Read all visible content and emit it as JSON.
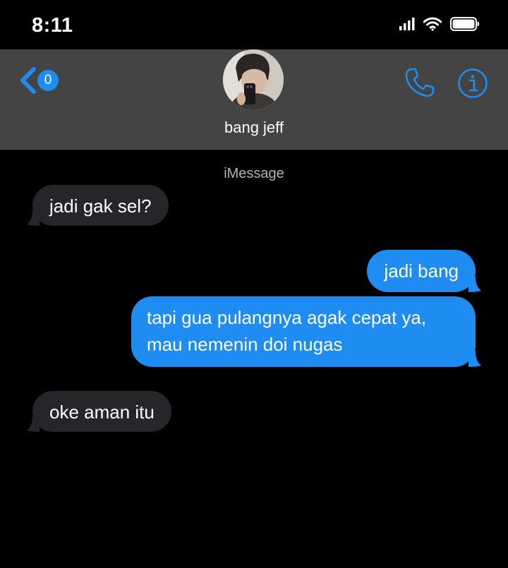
{
  "status_bar": {
    "time": "8:11",
    "icons": [
      "cellular-signal-icon",
      "wifi-icon",
      "battery-icon"
    ]
  },
  "header": {
    "back_badge_count": "0",
    "contact_name": "bang jeff",
    "actions": [
      "phone-icon",
      "info-icon"
    ]
  },
  "conversation": {
    "service_label": "iMessage",
    "messages": [
      {
        "direction": "incoming",
        "text": "jadi gak sel?"
      },
      {
        "direction": "outgoing",
        "text": "jadi bang"
      },
      {
        "direction": "outgoing",
        "text": "tapi gua pulangnya agak cepat ya,\nmau nemenin doi nugas"
      },
      {
        "direction": "incoming",
        "text": "oke aman itu"
      }
    ]
  },
  "colors": {
    "background": "#000000",
    "header_background": "#444444",
    "accent_blue": "#1e8cf0",
    "incoming_bubble": "#26262a",
    "service_label_gray": "#b4b4b8"
  }
}
